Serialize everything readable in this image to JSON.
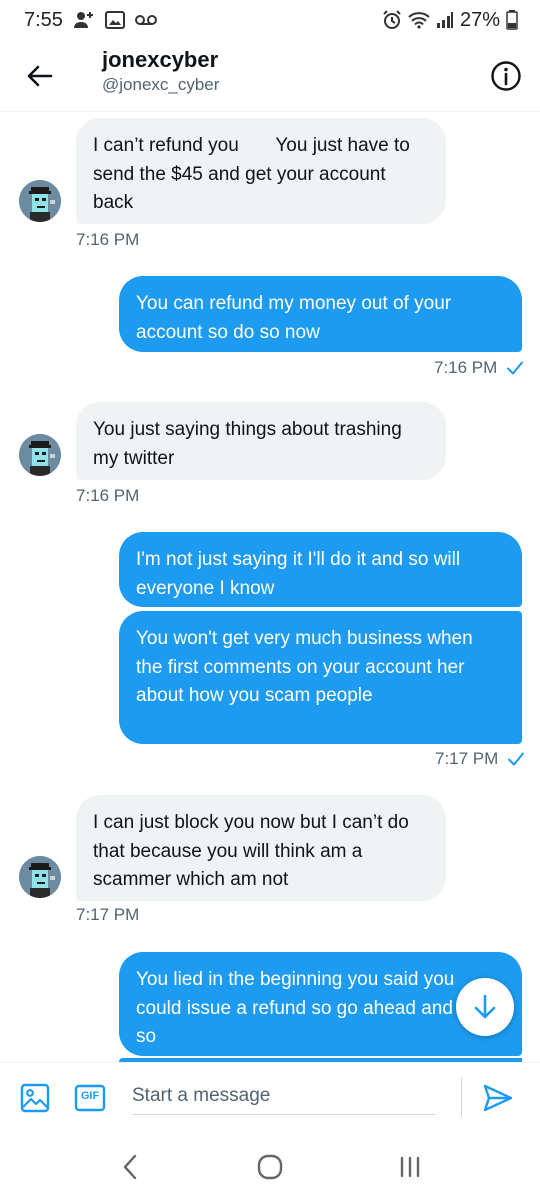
{
  "status_bar": {
    "time": "7:55",
    "battery": "27%"
  },
  "header": {
    "name": "jonexcyber",
    "handle": "@jonexc_cyber"
  },
  "messages": [
    {
      "direction": "in",
      "text": "I can’t refund you       You just have to send the $45 and get your account back"
    },
    {
      "direction": "in",
      "time": "7:16 PM"
    },
    {
      "direction": "out",
      "text": "You can refund my money out of your account so do so now"
    },
    {
      "direction": "out",
      "time": "7:16 PM"
    },
    {
      "direction": "in",
      "text": "You just saying things about trashing my twitter"
    },
    {
      "direction": "in",
      "time": "7:16 PM"
    },
    {
      "direction": "out",
      "text": "I'm not just saying it I'll do it and so will everyone I know"
    },
    {
      "direction": "out",
      "text": "You won't get very much business when the first comments on your account her about how you scam people"
    },
    {
      "direction": "out",
      "time": "7:17 PM"
    },
    {
      "direction": "in",
      "text": "I can just block you now but I can’t do that because you will think am a scammer which am not"
    },
    {
      "direction": "in",
      "time": "7:17 PM"
    },
    {
      "direction": "out",
      "text": "You lied in the beginning you said you could issue a refund so go ahead and do so"
    }
  ],
  "composer": {
    "placeholder": "Start a message",
    "gif_label": "GIF"
  },
  "colors": {
    "accent": "#1d9bf0",
    "incoming_bubble": "#eff3f4",
    "secondary_text": "#536471"
  },
  "icons": {
    "back": "arrow-left-icon",
    "info": "info-icon",
    "media": "image-icon",
    "gif": "gif-icon",
    "send": "send-icon",
    "scroll_down": "arrow-down-icon",
    "read_receipt": "check-icon"
  }
}
